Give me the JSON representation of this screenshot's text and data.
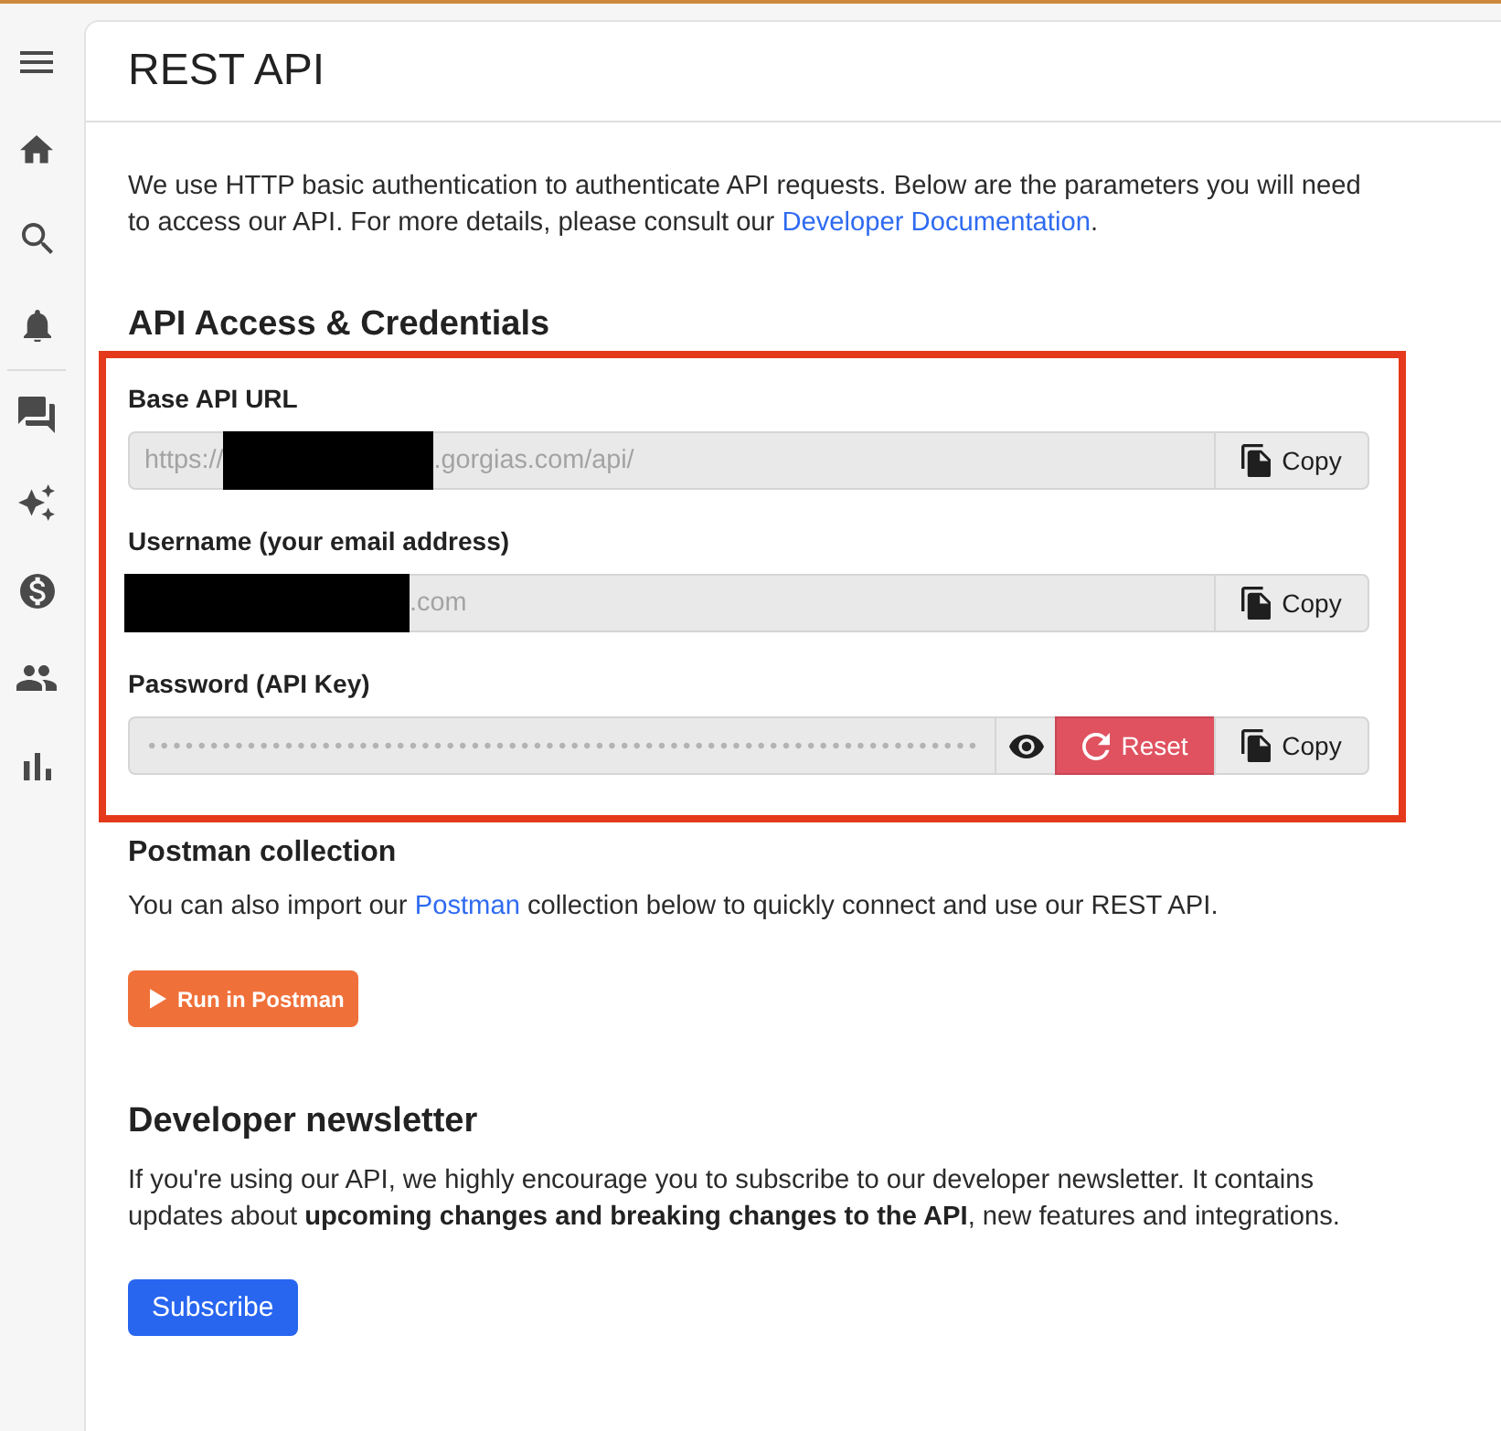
{
  "page": {
    "title": "REST API"
  },
  "intro": {
    "text": "We use HTTP basic authentication to authenticate API requests. Below are the parameters you will need to access our API. For more details, please consult our ",
    "link": "Developer Documentation",
    "text_after": "."
  },
  "credentials": {
    "heading": "API Access & Credentials",
    "fields": [
      {
        "label": "Base API URL",
        "value_parts": [
          {
            "kind": "text",
            "text": "https://"
          },
          {
            "kind": "redacted"
          },
          {
            "kind": "text",
            "text": ".gorgias.com/api/"
          }
        ],
        "actions": [
          {
            "kind": "copy",
            "label": "Copy"
          }
        ]
      },
      {
        "label": "Username (your email address)",
        "value_parts": [
          {
            "kind": "redacted"
          },
          {
            "kind": "text",
            "text": ".com"
          }
        ],
        "actions": [
          {
            "kind": "copy",
            "label": "Copy"
          }
        ]
      },
      {
        "label": "Password (API Key)",
        "value_parts": [
          {
            "kind": "masked",
            "text": "•••••••••••••••••••••••••••••••••••••••••••••••••••••••••••••••••••"
          }
        ],
        "actions": [
          {
            "kind": "reveal"
          },
          {
            "kind": "reset",
            "label": "Reset"
          },
          {
            "kind": "copy",
            "label": "Copy"
          }
        ]
      }
    ]
  },
  "postman": {
    "heading": "Postman collection",
    "text": "You can also import our ",
    "link": "Postman",
    "text_after": " collection below to quickly connect and use our REST API.",
    "button": "Run in Postman"
  },
  "newsletter": {
    "heading": "Developer newsletter",
    "text": "If you're using our API, we highly encourage you to subscribe to our developer newsletter. It contains updates about **upcoming changes and breaking changes to the API**, new features and integrations.",
    "button": "Subscribe"
  }
}
